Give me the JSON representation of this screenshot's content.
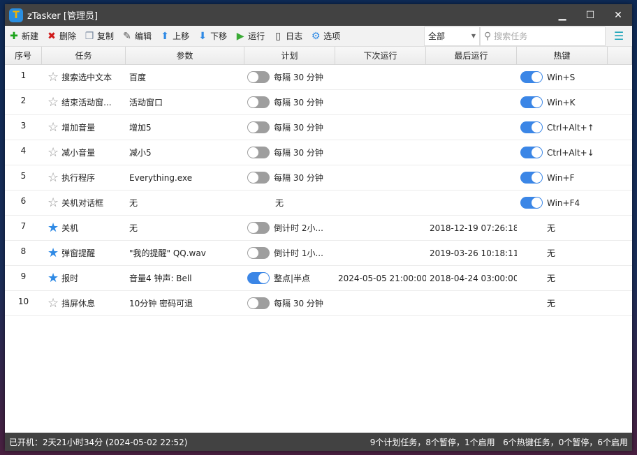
{
  "window": {
    "title": "zTasker [管理员]",
    "logo": "T",
    "minimize": "▁",
    "maximize": "☐",
    "close": "✕"
  },
  "toolbar": {
    "items": [
      {
        "label": "新建",
        "icon": "plus-icon",
        "glyph": "✚",
        "color": "#1aa31a"
      },
      {
        "label": "删除",
        "icon": "delete-x-icon",
        "glyph": "✖",
        "color": "#d01a1a"
      },
      {
        "label": "复制",
        "icon": "copy-icon",
        "glyph": "❐",
        "color": "#7a8aa0"
      },
      {
        "label": "编辑",
        "icon": "edit-icon",
        "glyph": "✎",
        "color": "#555"
      },
      {
        "label": "上移",
        "icon": "arrow-up-icon",
        "glyph": "⬆",
        "color": "#2f8ae5"
      },
      {
        "label": "下移",
        "icon": "arrow-down-icon",
        "glyph": "⬇",
        "color": "#2f8ae5"
      },
      {
        "label": "运行",
        "icon": "play-icon",
        "glyph": "▶",
        "color": "#3aaa35"
      },
      {
        "label": "日志",
        "icon": "log-icon",
        "glyph": "▯",
        "color": "#333"
      },
      {
        "label": "选项",
        "icon": "gear-icon",
        "glyph": "⚙",
        "color": "#2f8ae5"
      }
    ],
    "filter": "全部",
    "search_placeholder": "搜索任务"
  },
  "columns": [
    "序号",
    "任务",
    "参数",
    "计划",
    "下次运行",
    "最后运行",
    "热键",
    ""
  ],
  "rows": [
    {
      "no": "1",
      "fav": false,
      "task": "搜索选中文本",
      "param": "百度",
      "plan_on": false,
      "plan": "每隔 30 分钟",
      "next": "",
      "last": "",
      "hk_on": true,
      "hotkey": "Win+S"
    },
    {
      "no": "2",
      "fav": false,
      "task": "结束活动窗...",
      "param": "活动窗口",
      "plan_on": false,
      "plan": "每隔 30 分钟",
      "next": "",
      "last": "",
      "hk_on": true,
      "hotkey": "Win+K"
    },
    {
      "no": "3",
      "fav": false,
      "task": "增加音量",
      "param": "增加5",
      "plan_on": false,
      "plan": "每隔 30 分钟",
      "next": "",
      "last": "",
      "hk_on": true,
      "hotkey": "Ctrl+Alt+↑"
    },
    {
      "no": "4",
      "fav": false,
      "task": "减小音量",
      "param": "减小5",
      "plan_on": false,
      "plan": "每隔 30 分钟",
      "next": "",
      "last": "",
      "hk_on": true,
      "hotkey": "Ctrl+Alt+↓"
    },
    {
      "no": "5",
      "fav": false,
      "task": "执行程序",
      "param": "Everything.exe",
      "plan_on": false,
      "plan": "每隔 30 分钟",
      "next": "",
      "last": "",
      "hk_on": true,
      "hotkey": "Win+F"
    },
    {
      "no": "6",
      "fav": false,
      "task": "关机对话框",
      "param": "无",
      "plan_on": null,
      "plan": "无",
      "next": "",
      "last": "",
      "hk_on": true,
      "hotkey": "Win+F4"
    },
    {
      "no": "7",
      "fav": true,
      "task": "关机",
      "param": "无",
      "plan_on": false,
      "plan": "倒计时 2小...",
      "next": "",
      "last": "2018-12-19 07:26:18",
      "hk_on": null,
      "hotkey": "无"
    },
    {
      "no": "8",
      "fav": true,
      "task": "弹窗提醒",
      "param": "\"我的提醒\" QQ.wav",
      "plan_on": false,
      "plan": "倒计时 1小...",
      "next": "",
      "last": "2019-03-26 10:18:11",
      "hk_on": null,
      "hotkey": "无"
    },
    {
      "no": "9",
      "fav": true,
      "task": "报时",
      "param": "音量4 钟声: Bell",
      "plan_on": true,
      "plan": "整点|半点",
      "next": "2024-05-05 21:00:00",
      "last": "2018-04-24 03:00:00",
      "hk_on": null,
      "hotkey": "无"
    },
    {
      "no": "10",
      "fav": false,
      "task": "挡屏休息",
      "param": "10分钟 密码可退",
      "plan_on": false,
      "plan": "每隔 30 分钟",
      "next": "",
      "last": "",
      "hk_on": null,
      "hotkey": "无"
    }
  ],
  "status": {
    "uptime": "已开机：2天21小时34分 (2024-05-02 22:52)",
    "summary": "9个计划任务，8个暂停，1个启用   6个热键任务，0个暂停，6个启用"
  },
  "colors": {
    "accent": "#3b86e6",
    "titlebar": "#424242",
    "toggle_off": "#9e9e9e"
  }
}
